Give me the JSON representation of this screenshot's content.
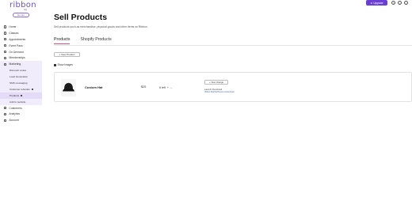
{
  "app": {
    "logo": "ribbon",
    "logo_sub": "HQ",
    "plan_button": "Go pro"
  },
  "topbar": {
    "upgrade_label": "Upgrade"
  },
  "sidebar": {
    "items": [
      {
        "label": "Home",
        "icon": "home-icon"
      },
      {
        "label": "Classes",
        "icon": "classes-icon"
      },
      {
        "label": "Appointments",
        "icon": "calendar-icon"
      },
      {
        "label": "Event Pass",
        "icon": "ticket-icon"
      },
      {
        "label": "On Demand",
        "icon": "video-icon"
      },
      {
        "label": "Memberships",
        "icon": "card-icon"
      }
    ],
    "marketing": {
      "label": "Marketing",
      "icon": "megaphone-icon",
      "subitems": [
        {
          "label": "Discount codes"
        },
        {
          "label": "Lead Generation"
        },
        {
          "label": "SMS messaging"
        },
        {
          "label": "Customer referrals"
        },
        {
          "label": "Products"
        },
        {
          "label": "Add to website"
        }
      ]
    },
    "bottom_items": [
      {
        "label": "Customers",
        "icon": "customers-icon"
      },
      {
        "label": "Analytics",
        "icon": "analytics-icon"
      },
      {
        "label": "Account",
        "icon": "account-icon"
      }
    ]
  },
  "main": {
    "title": "Sell Products",
    "subtitle": "Sell products such as merchandise, physical goods and other items on Ribbon.",
    "tabs": [
      {
        "label": "Products",
        "active": true
      },
      {
        "label": "Shopify Products",
        "active": false
      }
    ],
    "new_product_label": "New Product",
    "show_images_label": "Show Images",
    "products": [
      {
        "name": "Custom Hat",
        "price": "$25",
        "stock": "6 left",
        "new_change_label": "New change",
        "availability_label": "Launch thumbnail",
        "availability_link": "ribbon.fit/a/hat?event-customHat"
      }
    ]
  },
  "colors": {
    "accent": "#6b3fd6",
    "tab_underline": "#d94b7a",
    "sidebar_group_bg": "#f1ecfb",
    "sidebar_active_bg": "#e4dbf8"
  }
}
